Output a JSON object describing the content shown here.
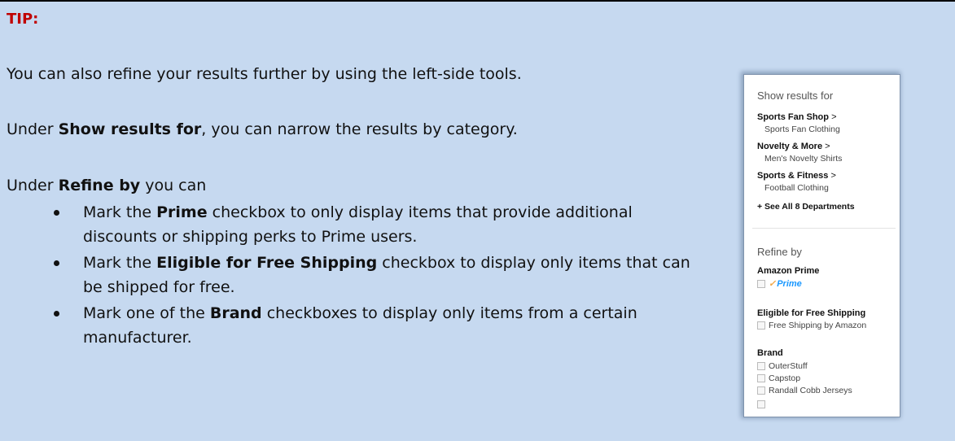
{
  "tip": {
    "label": "TIP:"
  },
  "paragraph1": "You can also refine your results further by using the left-side tools.",
  "paragraph2": {
    "pre": "Under ",
    "bold": "Show results for",
    "post": ", you can narrow the results by category."
  },
  "paragraph3": {
    "pre": "Under ",
    "bold": "Refine by",
    "post": " you can"
  },
  "bullets": [
    {
      "pre": "Mark the ",
      "bold": "Prime",
      "post": " checkbox to only display items that provide additional discounts or shipping perks to Prime users."
    },
    {
      "pre": "Mark the ",
      "bold": "Eligible for Free Shipping",
      "post": " checkbox to display only items that can be shipped for free."
    },
    {
      "pre": "Mark one of the ",
      "bold": "Brand",
      "post": " checkboxes to display only items from a certain manufacturer."
    }
  ],
  "sidebar": {
    "show_results_heading": "Show results for",
    "departments": [
      {
        "name": "Sports Fan Shop",
        "chevron": ">",
        "sub": "Sports Fan Clothing"
      },
      {
        "name": "Novelty & More",
        "chevron": ">",
        "sub": "Men's Novelty Shirts"
      },
      {
        "name": "Sports & Fitness",
        "chevron": ">",
        "sub": "Football Clothing"
      }
    ],
    "see_all": "+ See All 8 Departments",
    "refine_heading": "Refine by",
    "amazon_prime_heading": "Amazon Prime",
    "prime_logo": "Prime",
    "free_shipping_heading": "Eligible for Free Shipping",
    "free_shipping_option": "Free Shipping by Amazon",
    "brand_heading": "Brand",
    "brands": [
      "OuterStuff",
      "Capstop",
      "Randall Cobb Jerseys"
    ]
  }
}
